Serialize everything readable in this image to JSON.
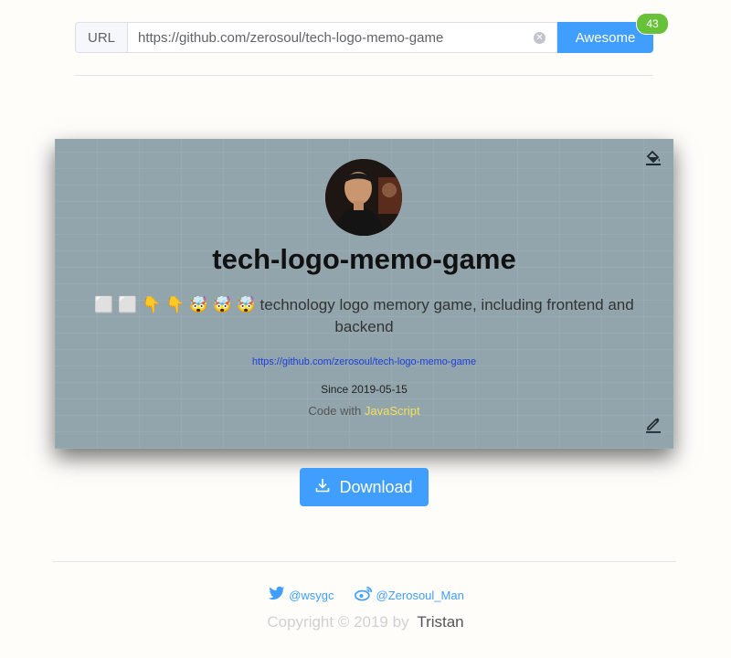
{
  "search": {
    "prepend_label": "URL",
    "value": "https://github.com/zerosoul/tech-logo-memo-game",
    "button_label": "Awesome",
    "badge_count": "43"
  },
  "card": {
    "title": "tech-logo-memo-game",
    "description": "⬜ ⬜ 👇 👇 🤯 🤯 🤯 technology logo memory game, including frontend and backend",
    "link": "https://github.com/zerosoul/tech-logo-memo-game",
    "since": "Since 2019-05-15",
    "code_with_label": "Code with",
    "language": "JavaScript",
    "language_color": "#f1e05a",
    "background_color": "#93a5ac"
  },
  "download": {
    "label": "Download"
  },
  "footer": {
    "twitter": "@wsygc",
    "weibo": "@Zerosoul_Man",
    "copyright": "Copyright © 2019 by",
    "author": "Tristan"
  },
  "colors": {
    "primary": "#409eff",
    "badge": "#67c23a"
  },
  "icons": [
    "clear-icon",
    "paint-bucket-icon",
    "edit-icon",
    "download-icon",
    "twitter-icon",
    "weibo-icon"
  ]
}
